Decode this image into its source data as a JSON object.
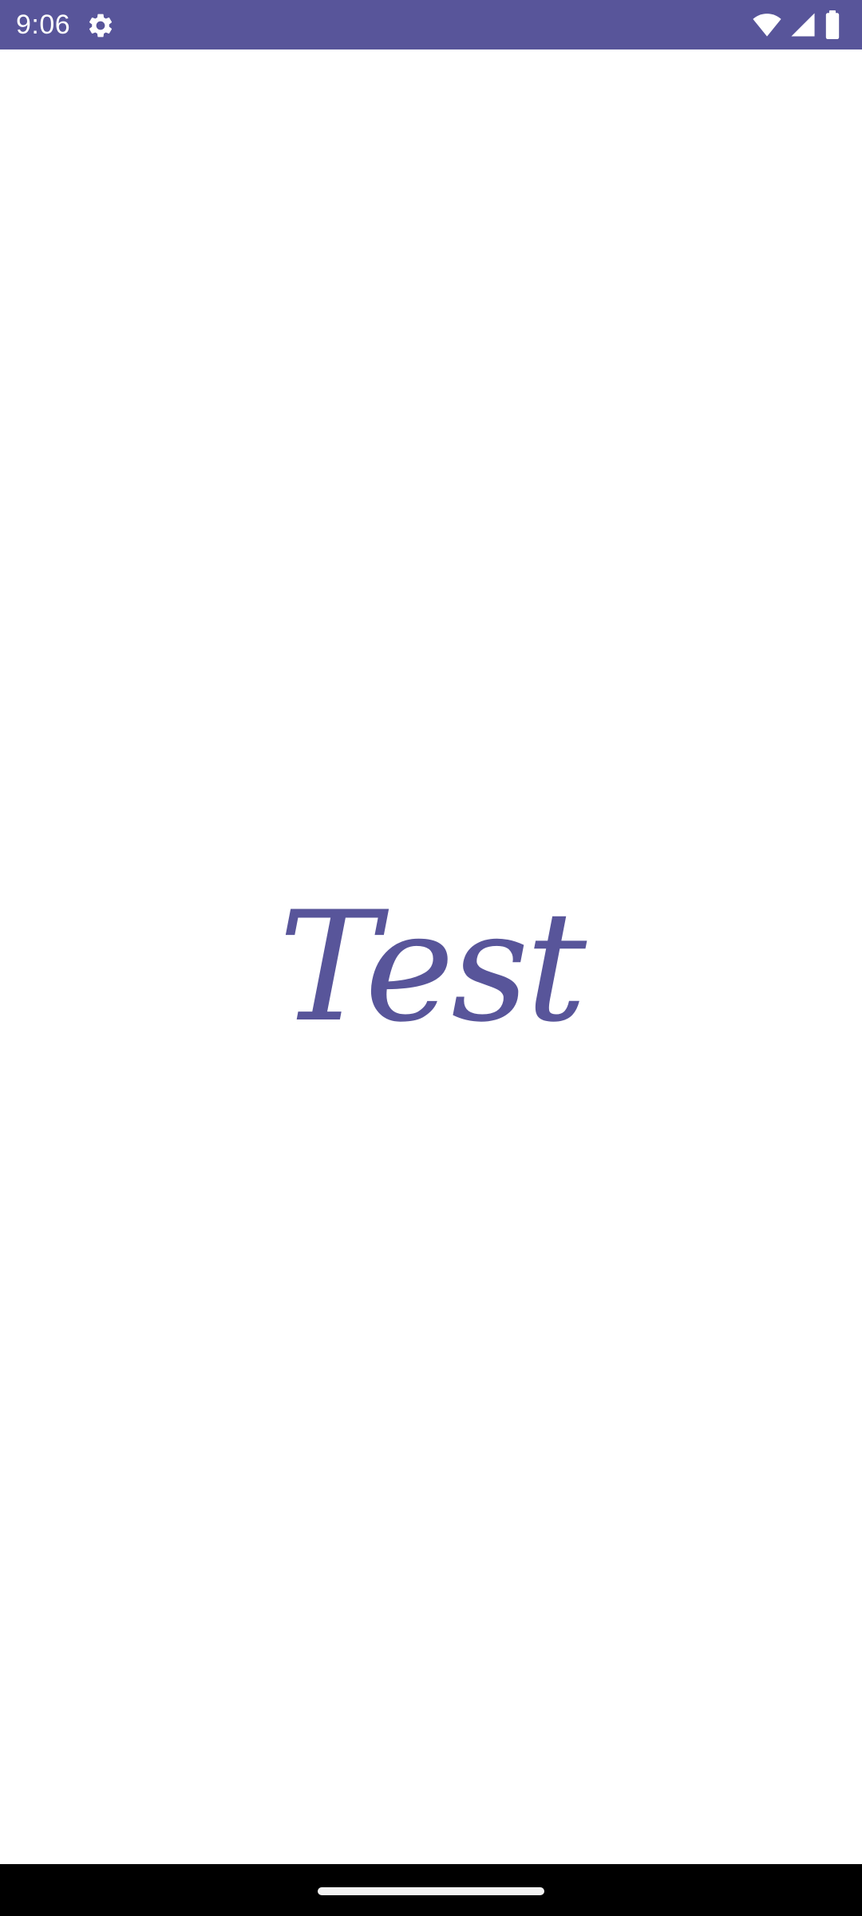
{
  "status_bar": {
    "time": "9:06",
    "background": "#58559a",
    "icons": [
      "gear-icon",
      "wifi-icon",
      "cellular-signal-icon",
      "battery-icon"
    ]
  },
  "splash": {
    "title": "Test",
    "color": "#58559a"
  },
  "nav_bar": {
    "background": "#000000",
    "handle": "home-gesture-pill"
  }
}
